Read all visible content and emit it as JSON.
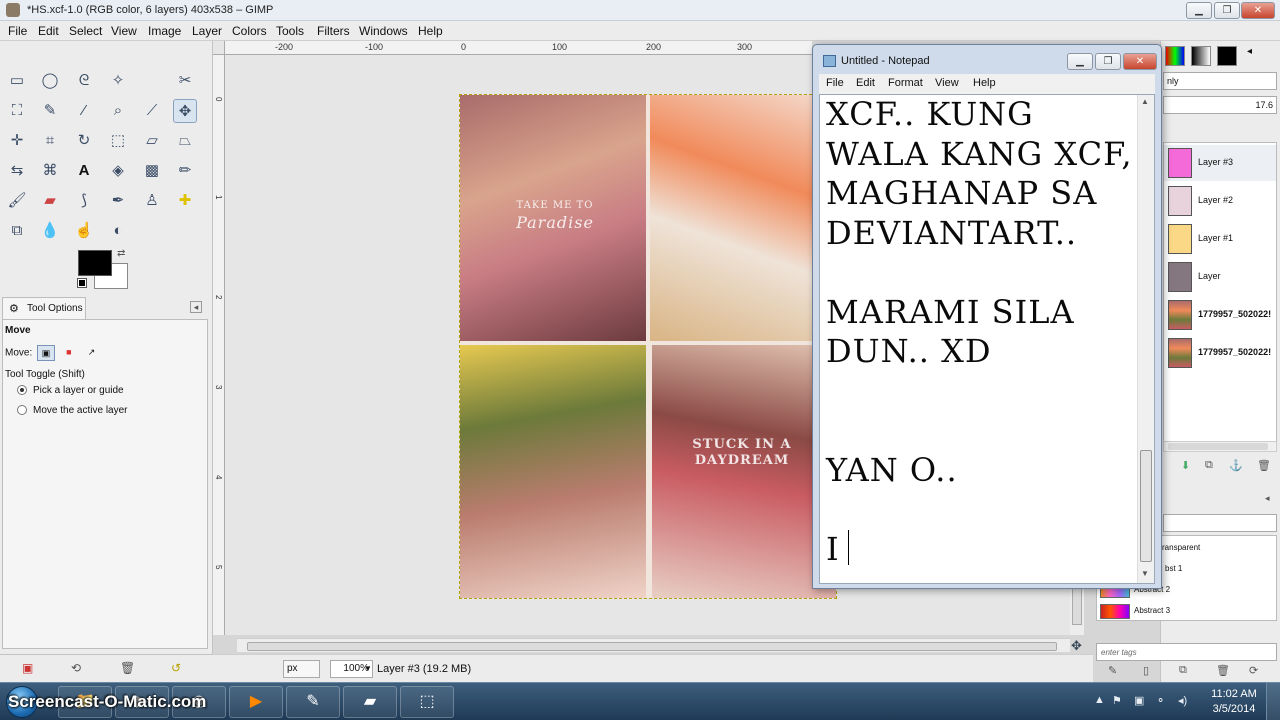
{
  "gimp": {
    "title": "*HS.xcf-1.0 (RGB color, 6 layers) 403x538 – GIMP",
    "menu": [
      "File",
      "Edit",
      "Select",
      "View",
      "Image",
      "Layer",
      "Colors",
      "Tools",
      "Filters",
      "Windows",
      "Help"
    ],
    "rulers": {
      "top": [
        "-200",
        "-100",
        "0",
        "100",
        "200",
        "300"
      ],
      "left": [
        "0",
        "1",
        "2",
        "3",
        "4",
        "5"
      ]
    },
    "tool_options": {
      "tab_label": "Tool Options",
      "heading": "Move",
      "move_label": "Move:",
      "toggle_label": "Tool Toggle  (Shift)",
      "option_1": "Pick a layer or guide",
      "option_2": "Move the active layer"
    },
    "image_overlay": {
      "tile1_line1": "TAKE ME TO",
      "tile1_line2": "Paradise",
      "tile4_line1": "STUCK IN A",
      "tile4_line2": "DAYDREAM"
    },
    "statusbar": {
      "unit": "px",
      "zoom": "100%",
      "text": "Layer #3 (19.2 MB)"
    },
    "dock": {
      "mode_fragment": "nly",
      "opacity_value": "17.6",
      "layers": [
        {
          "name": "Layer #3",
          "color": "#f46ad8",
          "selected": true
        },
        {
          "name": "Layer #2",
          "color": "#e8d3dc"
        },
        {
          "name": "Layer #1",
          "color": "#fbd885"
        },
        {
          "name": "Layer",
          "color": "#857780"
        },
        {
          "name": "1779957_502022!",
          "color": "#c89a82"
        },
        {
          "name": "1779957_502022!",
          "color": "#c89a82"
        }
      ],
      "gradients": [
        {
          "name": "ransparent"
        },
        {
          "name": "bst 1"
        },
        {
          "name": "Abstract 2"
        },
        {
          "name": "Abstract 3"
        }
      ],
      "tags_placeholder": "enter tags"
    }
  },
  "notepad": {
    "title": "Untitled - Notepad",
    "menu": [
      "File",
      "Edit",
      "Format",
      "View",
      "Help"
    ],
    "content": "XCF.. KUNG\nWALA KANG XCF,\nMAGHANAP SA\nDEVIANTART..\n\nMARAMI SILA\nDUN.. XD\n\n\nYAN O..\n\nI"
  },
  "taskbar": {
    "watermark": "Screencast-O-Matic.com",
    "time": "11:02 AM",
    "date": "3/5/2014"
  }
}
